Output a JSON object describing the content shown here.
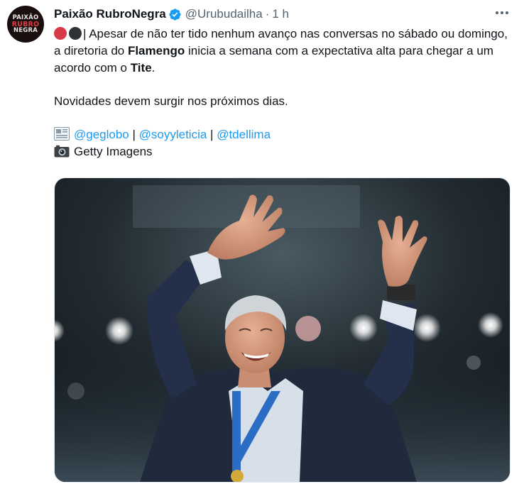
{
  "tweet": {
    "display_name": "Paixão RubroNegra",
    "handle": "@Urubudailha",
    "separator": "·",
    "time": "1 h",
    "avatar_lines": [
      "PAIXÃO",
      "RUBRO",
      "NEGRA"
    ],
    "text": {
      "p1_part1": "| Apesar de não ter tido nenhum avanço nas conversas no sábado ou domingo, a diretoria do ",
      "p1_bold1": "Flamengo",
      "p1_part2": " inicia a semana com a expectativa alta para chegar a um acordo com o ",
      "p1_bold2": "Tite",
      "p1_part3": ".",
      "p2": "Novidades devem surgir nos próximos dias.",
      "mentions": [
        "@geglobo",
        "@soyyleticia",
        "@tdellima"
      ],
      "mention_separator": " | ",
      "photo_credit": "Getty Imagens"
    },
    "colors": {
      "accent": "#1d9bf0",
      "red_circle": "#d93a47",
      "black_circle": "#2f3336",
      "secondary_text": "#536471"
    },
    "icons": [
      "verified-badge-icon",
      "more-options-icon",
      "red-circle-icon",
      "black-circle-icon",
      "newspaper-icon",
      "camera-icon"
    ]
  }
}
